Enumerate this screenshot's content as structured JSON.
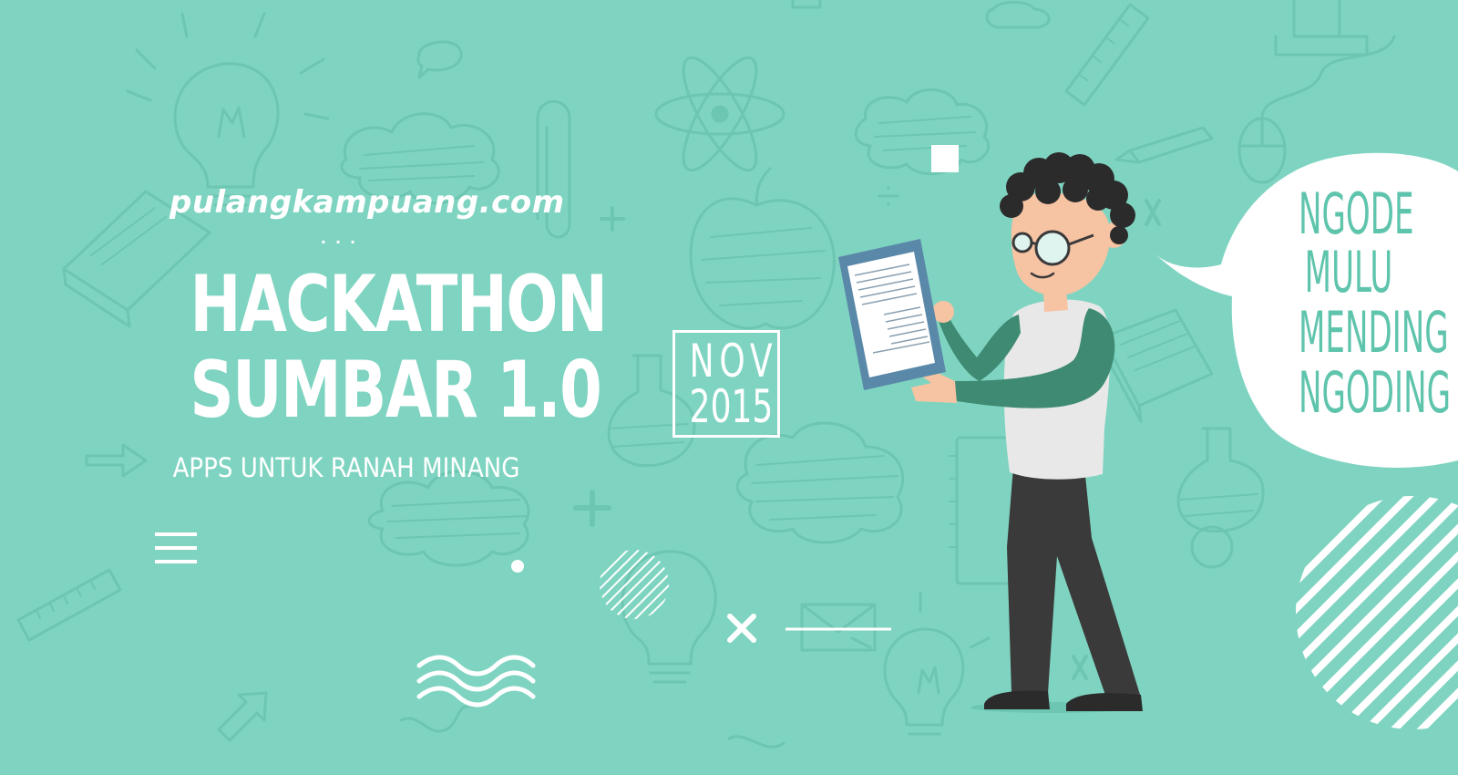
{
  "header": {
    "site": "pulangkampuang.com",
    "dots": "...",
    "title_line1": "HACKATHON",
    "title_line2": "SUMBAR 1.0",
    "subtitle": "APPS UNTUK RANAH MINANG"
  },
  "date": {
    "month": "NOV",
    "year": "2015"
  },
  "speech_bubble": {
    "lines": [
      "NGODE",
      "MULU",
      "MENDING",
      "NGODING"
    ]
  },
  "colors": {
    "background": "#7fd4c1",
    "doodle": "#6cc6b1",
    "white": "#ffffff",
    "bubble_text": "#5fc4ac",
    "shirt_sleeve": "#3e8a72",
    "pants": "#3a3a3a",
    "hair": "#2b2b2b",
    "skin": "#f6c3a3",
    "tablet": "#5a88a8"
  },
  "icons": [
    "lightbulb-icon",
    "atom-icon",
    "paperclip-icon",
    "apple-icon",
    "flask-icon",
    "cloud-icon",
    "book-icon",
    "ruler-icon",
    "pencil-icon",
    "mouse-icon",
    "envelope-icon",
    "plus-icon",
    "hamburger-icon",
    "close-x-icon",
    "wave-icon",
    "hatched-circle-icon"
  ]
}
